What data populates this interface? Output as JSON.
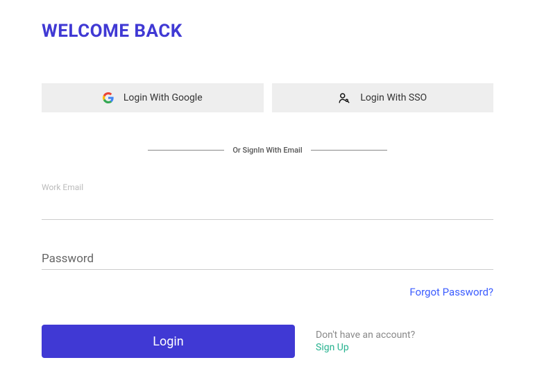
{
  "title": "WELCOME BACK",
  "oauth": {
    "google": "Login With Google",
    "sso": "Login With SSO"
  },
  "divider": "Or SignIn With Email",
  "fields": {
    "email": {
      "label": "Work Email",
      "value": ""
    },
    "password": {
      "placeholder": "Password",
      "value": ""
    }
  },
  "forgot": "Forgot Password?",
  "login": "Login",
  "signup": {
    "prompt": "Don't have an account?",
    "link": "Sign Up"
  }
}
